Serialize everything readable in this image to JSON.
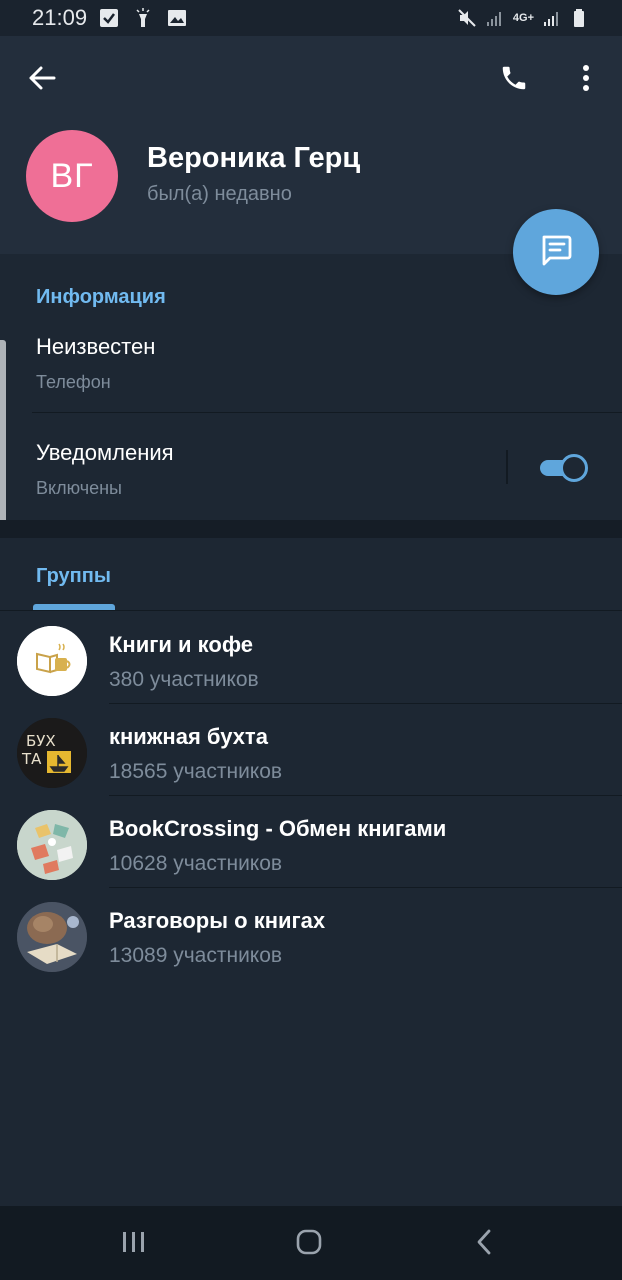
{
  "status_bar": {
    "time": "21:09",
    "icons_left": [
      "check-box-icon",
      "flashlight-icon",
      "image-icon"
    ],
    "icons_right": [
      "mute-icon",
      "signal-icon",
      "4g-icon",
      "signal-icon",
      "battery-icon"
    ],
    "network": "4G+"
  },
  "toolbar": {
    "back_icon": "arrow-left-icon",
    "call_icon": "phone-icon",
    "menu_icon": "more-vertical-icon"
  },
  "profile": {
    "initials": "ВГ",
    "avatar_color": "#ef6f96",
    "name": "Вероника Герц",
    "status": "был(а) недавно"
  },
  "fab": {
    "icon": "message-icon",
    "color": "#5fa6dc"
  },
  "info": {
    "title": "Информация",
    "phone_value": "Неизвестен",
    "phone_label": "Телефон",
    "notifications_title": "Уведомления",
    "notifications_state": "Включены",
    "notifications_on": true
  },
  "groups_tab": {
    "label": "Группы"
  },
  "groups": [
    {
      "title": "Книги и кофе",
      "members": "380 участников"
    },
    {
      "title": "книжная бухта",
      "members": "18565 участников"
    },
    {
      "title": "BookCrossing - Обмен книгами",
      "members": "10628 участников"
    },
    {
      "title": "Разговоры о книгах",
      "members": "13089 участников"
    }
  ],
  "group_avatar_text": {
    "bukhta_line1": "БУХ",
    "bukhta_line2": "ТА"
  },
  "colors": {
    "background": "#1d2733",
    "header": "#232e3c",
    "accent": "#5fa6dc",
    "section_title": "#71baf0",
    "secondary_text": "#7e8c9b"
  },
  "nav_bar": {
    "recents_icon": "recents-icon",
    "home_icon": "home-icon",
    "back_icon": "nav-back-icon"
  }
}
